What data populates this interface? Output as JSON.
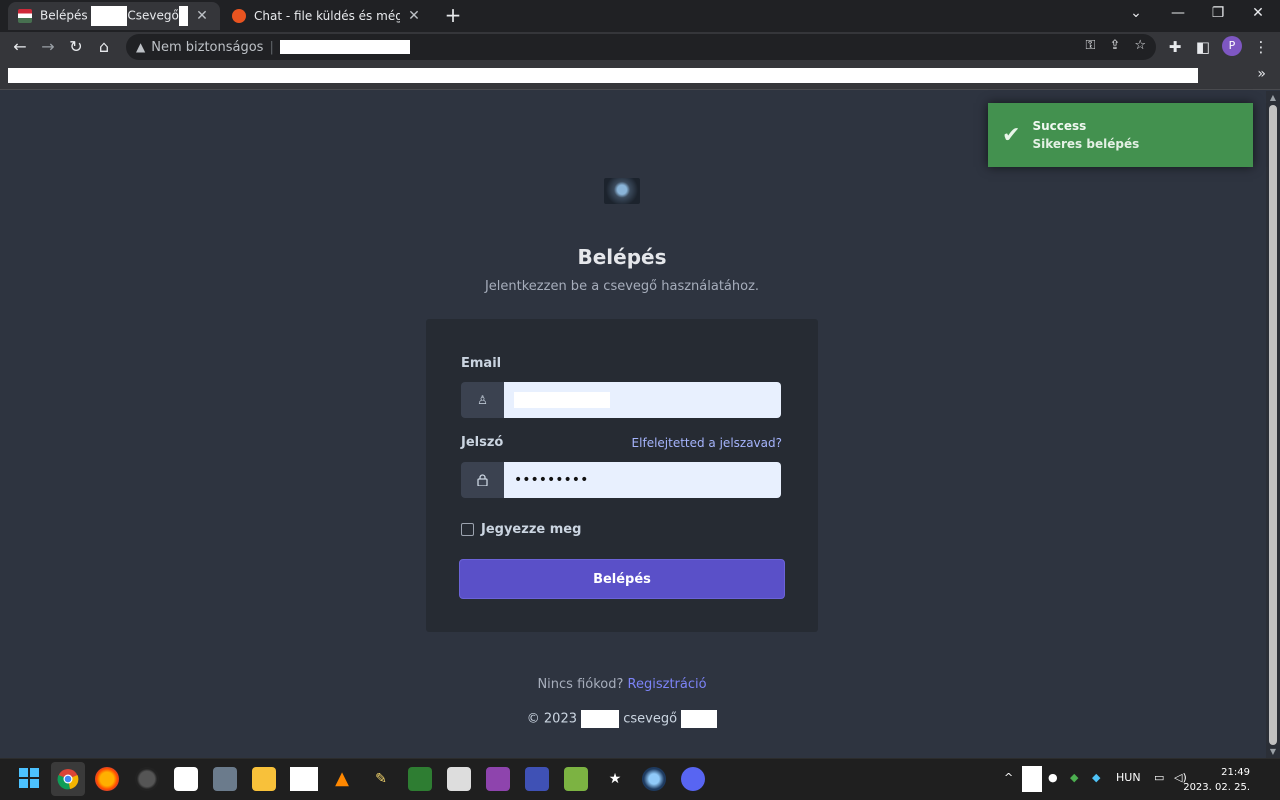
{
  "browser": {
    "tabs": [
      {
        "title_pre": "Belépés",
        "title_mid": "Csevegő",
        "close": "✕"
      },
      {
        "title": "Chat - file küldés és még hívás p",
        "close": "✕"
      }
    ],
    "new_tab": "+",
    "window_controls": {
      "tab_search": "⌄",
      "minimize": "—",
      "restore": "❐",
      "close": "✕"
    },
    "nav": {
      "back": "←",
      "forward": "→",
      "reload": "↻",
      "home": "⌂"
    },
    "address": {
      "security_label": "Nem biztonságos",
      "warn_icon": "▲"
    },
    "omni_icons": {
      "key": "⚿",
      "share": "⇪",
      "star": "☆"
    },
    "toolbar_icons": {
      "extensions": "✚",
      "sidepanel": "◧",
      "menu": "⋮"
    },
    "profile_initial": "P",
    "bookmarks_more": "»"
  },
  "toast": {
    "title": "Success",
    "message": "Sikeres belépés",
    "icon": "✔",
    "color": "#43914f"
  },
  "login": {
    "heading": "Belépés",
    "subheading": "Jelentkezzen be a csevegő használatához.",
    "email_label": "Email",
    "password_label": "Jelszó",
    "forgot_link": "Elfelejtetted a jelszavad?",
    "password_value": "•••••••••",
    "user_icon": "♙",
    "lock_icon": "🔒",
    "remember_label": "Jegyezze meg",
    "submit_label": "Belépés",
    "accent_color": "#5a50c8"
  },
  "footer": {
    "register_prompt": "Nincs fiókod?",
    "register_link": "Regisztráció",
    "copyright_pre": "© 2023",
    "copyright_mid": "csevegő"
  },
  "taskbar": {
    "tray_chevron": "^",
    "language": "HUN",
    "time": "21:49",
    "date": "2023. 02. 25."
  }
}
